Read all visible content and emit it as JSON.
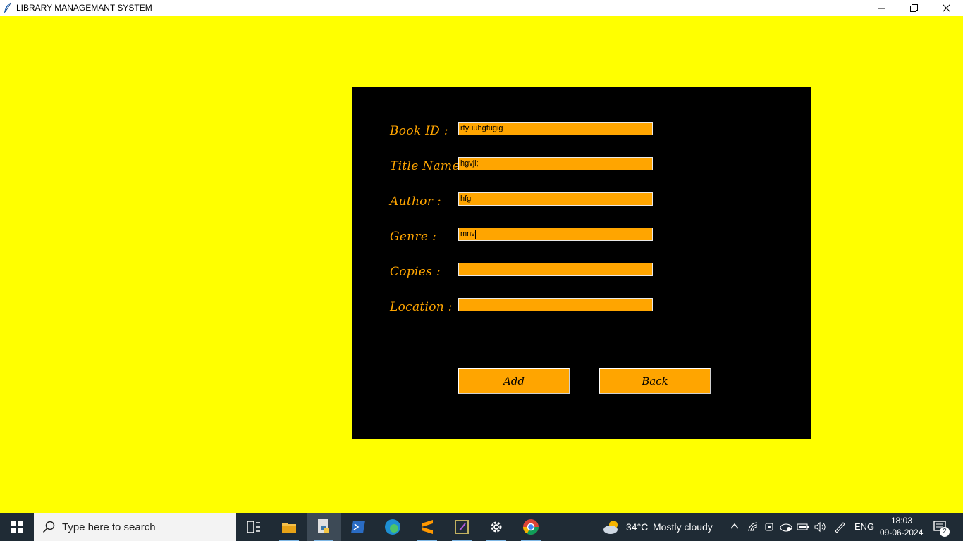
{
  "window": {
    "title": "LIBRARY MANAGEMANT SYSTEM"
  },
  "form": {
    "book_id_label": "Book ID :",
    "book_id_value": "rtyuuhgfugig",
    "title_label": "Title Name :",
    "title_value": "hgvjl;",
    "author_label": "Author :",
    "author_value": "hfg",
    "genre_label": "Genre :",
    "genre_value": "mnv",
    "copies_label": "Copies :",
    "copies_value": "",
    "location_label": "Location :",
    "location_value": ""
  },
  "buttons": {
    "add_label": "Add",
    "back_label": "Back"
  },
  "taskbar": {
    "search_placeholder": "Type here to search",
    "weather_temp": "34°C",
    "weather_text": "Mostly cloudy",
    "language": "ENG",
    "time": "18:03",
    "date": "09-06-2024",
    "notification_count": "2"
  },
  "colors": {
    "background": "#ffff00",
    "panel": "#000000",
    "accent": "#ffa500"
  }
}
